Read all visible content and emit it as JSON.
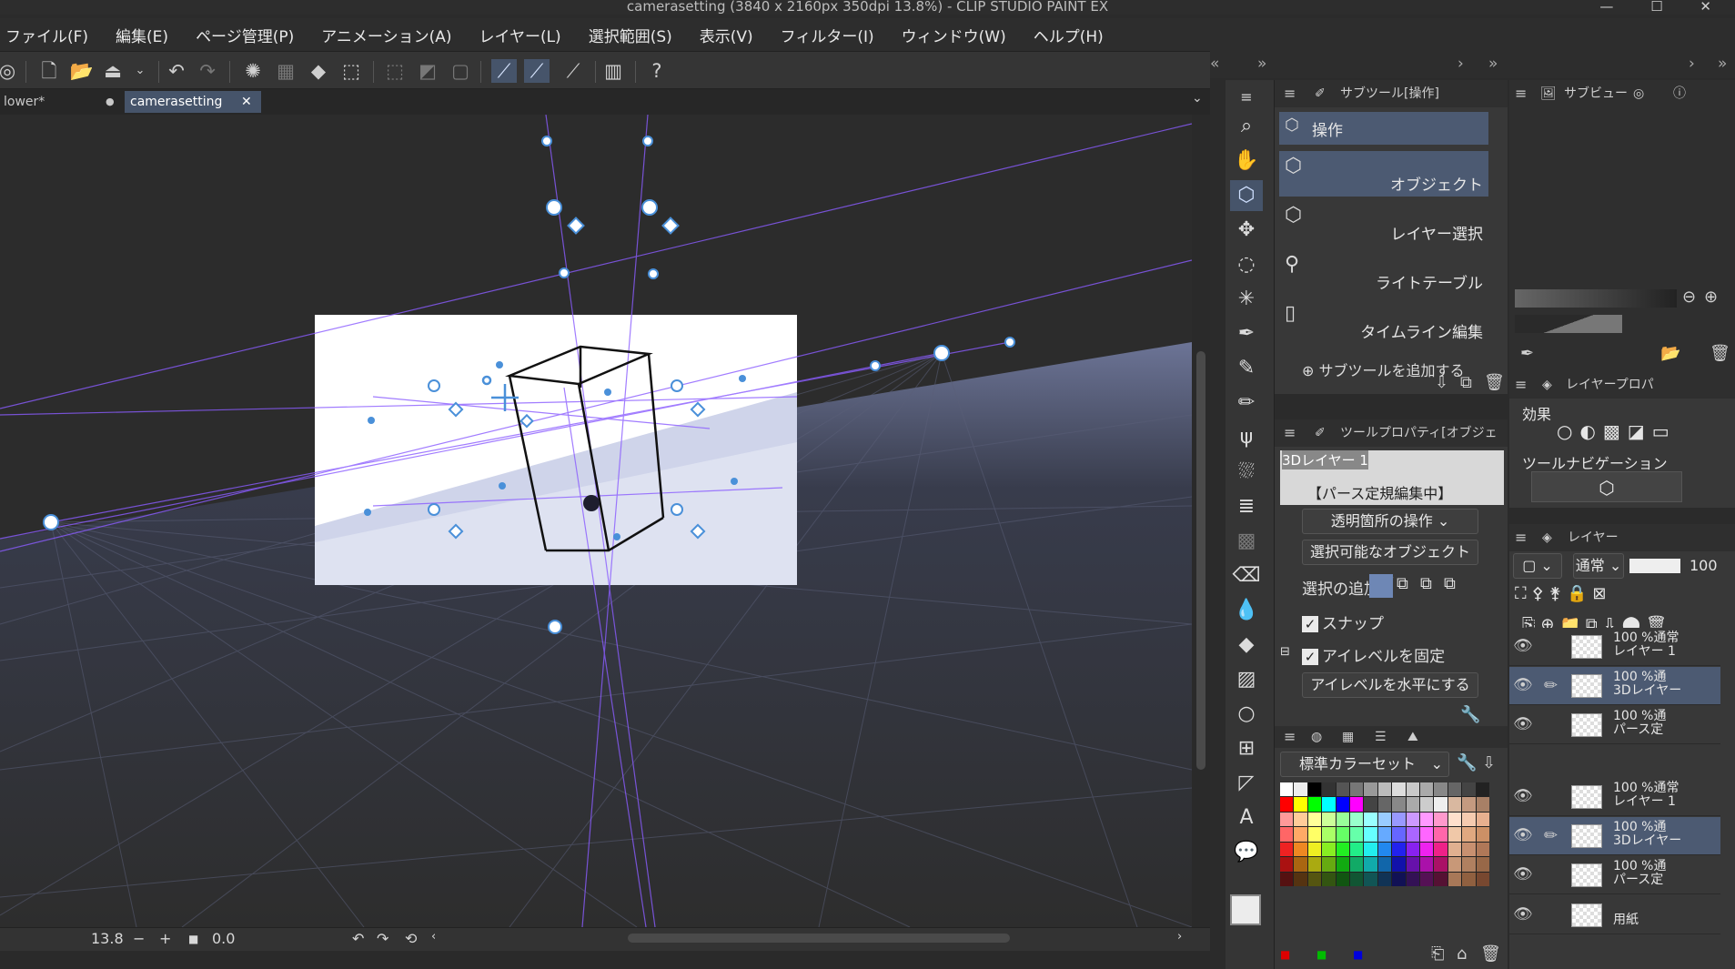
{
  "window": {
    "title": "camerasetting (3840 x 2160px 350dpi 13.8%)  - CLIP STUDIO PAINT EX",
    "controls": [
      "—",
      "☐",
      "✕"
    ]
  },
  "menu": [
    "ファイル(F)",
    "編集(E)",
    "ページ管理(P)",
    "アニメーション(A)",
    "レイヤー(L)",
    "選択範囲(S)",
    "表示(V)",
    "フィルター(I)",
    "ウィンドウ(W)",
    "ヘルプ(H)"
  ],
  "tabs": [
    {
      "label": "lower*",
      "close": "●"
    },
    {
      "label": "camerasetting",
      "close": "✕"
    }
  ],
  "status": {
    "zoom": "13.8",
    "angle": "0.0",
    "minus": "−",
    "plus": "+"
  },
  "subtool_panel": {
    "title": "サブツール[操作]",
    "group": "操作",
    "items": [
      "オブジェクト",
      "レイヤー選択",
      "ライトテーブル",
      "タイムライン編集"
    ],
    "add": "サブツールを追加する"
  },
  "tool_property": {
    "title": "ツールプロパティ[オブジェ",
    "layer_name": "3Dレイヤー 1",
    "editing": "【パース定規編集中】",
    "dropdown1": "透明箇所の操作",
    "dropdown2": "選択可能なオブジェクト",
    "add_selection": "選択の追加",
    "snap": "スナップ",
    "lock_eye": "アイレベルを固定",
    "eye_horizontal": "アイレベルを水平にする"
  },
  "color_set": {
    "title": "標準カラーセット"
  },
  "sub_view": {
    "title": "サブビュー"
  },
  "layer_property": {
    "title": "レイヤープロパ",
    "effect": "効果",
    "tool_nav": "ツールナビゲーション"
  },
  "layers_panel": {
    "title": "レイヤー",
    "blend_mode": "通常",
    "opacity": "100",
    "rows": [
      {
        "line1": "100 %通常",
        "line2": "レイヤー 1",
        "sel": false
      },
      {
        "line1": "100 %通",
        "line2": "3Dレイヤー",
        "sel": true
      },
      {
        "line1": "100 %通",
        "line2": "パース定",
        "sel": false
      },
      {
        "line1": "100 %通常",
        "line2": "レイヤー 1",
        "sel": false
      },
      {
        "line1": "100 %通",
        "line2": "3Dレイヤー",
        "sel": true
      },
      {
        "line1": "100 %通",
        "line2": "パース定",
        "sel": false
      },
      {
        "line1": "",
        "line2": "用紙",
        "sel": false
      }
    ]
  },
  "colors": {
    "accent_selected": "#4c5a72",
    "ruler_line": "#8a5cff",
    "handle": "#4a90d9",
    "bg": "#2b2b2b"
  }
}
